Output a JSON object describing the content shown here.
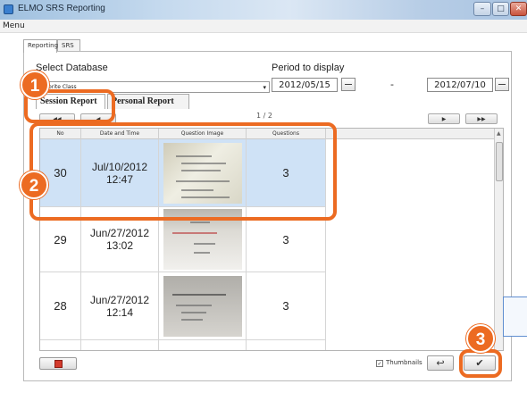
{
  "window": {
    "title": "ELMO SRS Reporting"
  },
  "menu": {
    "label": "Menu"
  },
  "tabs": [
    {
      "label": "Reporting"
    },
    {
      "label": "SRS"
    }
  ],
  "database": {
    "label": "Select Database",
    "value": "Favorite Class"
  },
  "period": {
    "label": "Period to display",
    "from": "2012/05/15",
    "separator": "-",
    "to": "2012/07/10"
  },
  "report_tabs": [
    {
      "label": "Session Report"
    },
    {
      "label": "Personal Report"
    }
  ],
  "pager": {
    "first": "◀◀",
    "prev": "◀",
    "info": "1 / 2",
    "next": "▶",
    "last": "▶▶"
  },
  "table": {
    "columns": [
      "No",
      "Date and Time",
      "Question Image",
      "Questions"
    ],
    "rows": [
      {
        "no": "30",
        "date": "Jul/10/2012",
        "time": "12:47",
        "questions": "3",
        "selected": true
      },
      {
        "no": "29",
        "date": "Jun/27/2012",
        "time": "13:02",
        "questions": "3",
        "selected": false
      },
      {
        "no": "28",
        "date": "Jun/27/2012",
        "time": "12:14",
        "questions": "3",
        "selected": false
      }
    ]
  },
  "footer": {
    "thumbnails_label": "Thumbnails",
    "thumbnails_checked": "✓",
    "undo_glyph": "↩",
    "ok_glyph": "✔"
  },
  "icons": {
    "delete": "trash-icon",
    "undo": "undo-icon",
    "ok": "checkmark-icon"
  },
  "callouts": [
    {
      "number": "1"
    },
    {
      "number": "2"
    },
    {
      "number": "3"
    }
  ],
  "colors": {
    "callout": "#ec6b22",
    "selected_row": "#cfe2f6",
    "delete_icon": "#d33a2c"
  }
}
